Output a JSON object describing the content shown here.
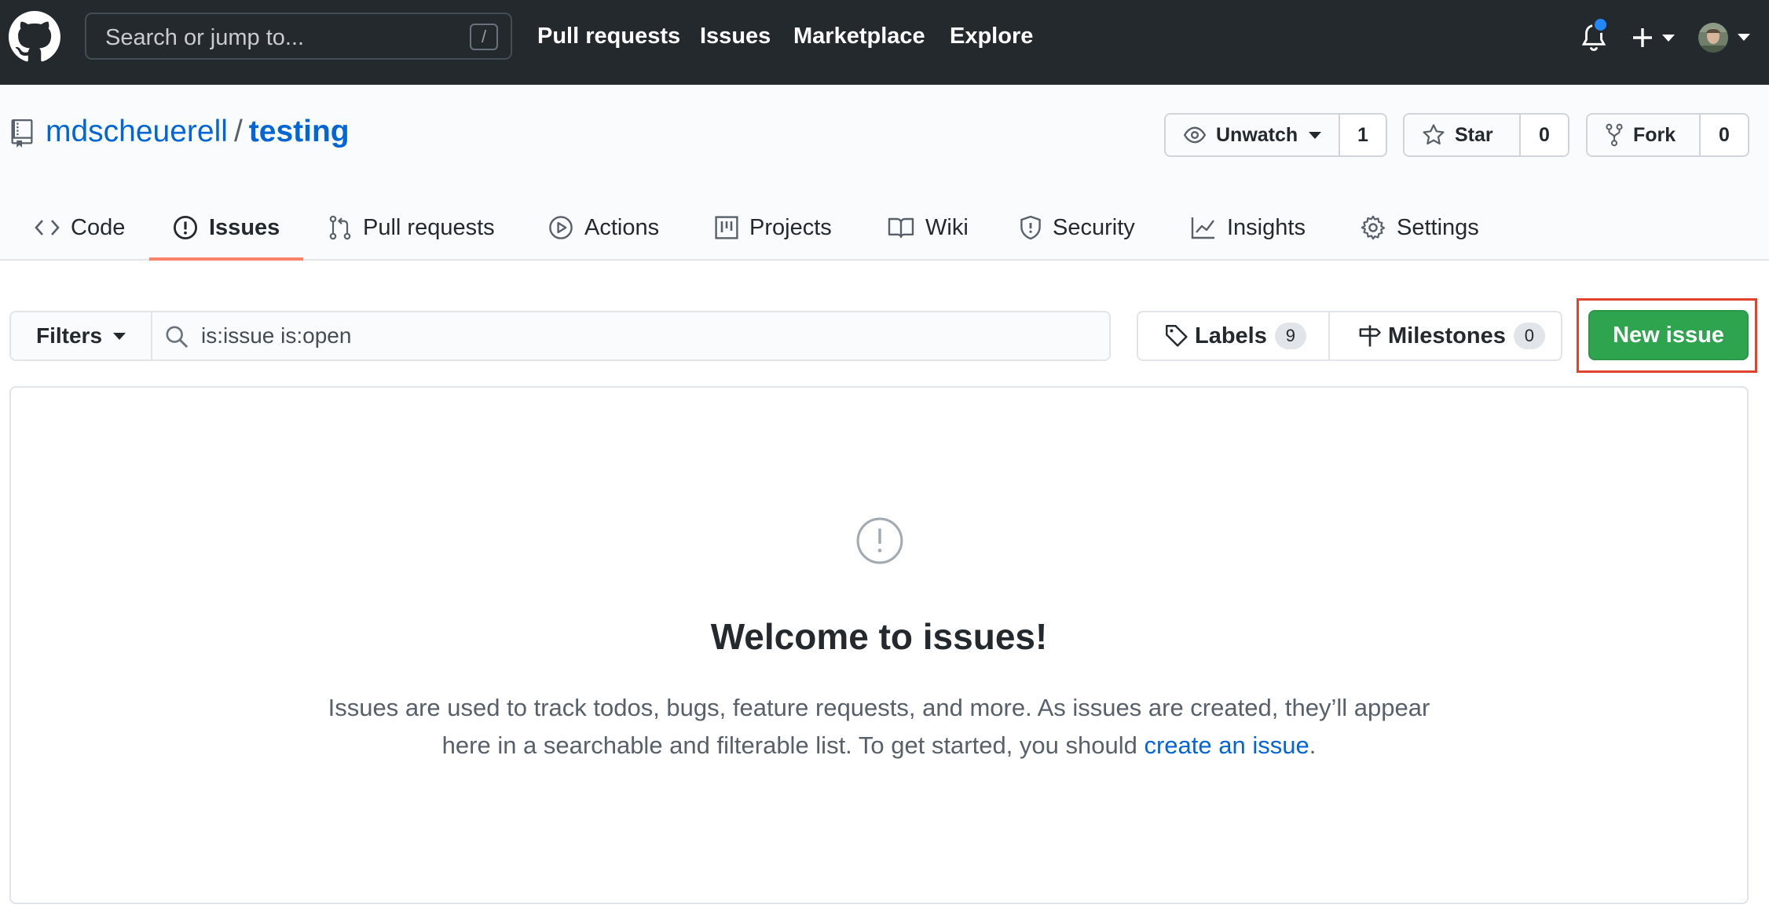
{
  "header": {
    "search_placeholder": "Search or jump to...",
    "search_shortcut": "/",
    "nav": [
      "Pull requests",
      "Issues",
      "Marketplace",
      "Explore"
    ]
  },
  "repo": {
    "owner": "mdscheuerell",
    "separator": "/",
    "name": "testing",
    "watch_label": "Unwatch",
    "watch_count": "1",
    "star_label": "Star",
    "star_count": "0",
    "fork_label": "Fork",
    "fork_count": "0"
  },
  "tabs": [
    {
      "label": "Code",
      "icon": "code-icon"
    },
    {
      "label": "Issues",
      "icon": "issue-opened-icon",
      "selected": true
    },
    {
      "label": "Pull requests",
      "icon": "git-pull-request-icon"
    },
    {
      "label": "Actions",
      "icon": "play-icon"
    },
    {
      "label": "Projects",
      "icon": "project-icon"
    },
    {
      "label": "Wiki",
      "icon": "book-icon"
    },
    {
      "label": "Security",
      "icon": "shield-icon"
    },
    {
      "label": "Insights",
      "icon": "graph-icon"
    },
    {
      "label": "Settings",
      "icon": "gear-icon"
    }
  ],
  "subnav": {
    "filters_label": "Filters",
    "search_value": "is:issue is:open",
    "labels_label": "Labels",
    "labels_count": "9",
    "milestones_label": "Milestones",
    "milestones_count": "0",
    "new_issue_label": "New issue"
  },
  "blankslate": {
    "title": "Welcome to issues!",
    "text_before": "Issues are used to track todos, bugs, feature requests, and more. As issues are created, they’ll appear here in a searchable and filterable list. To get started, you should ",
    "link": "create an issue",
    "text_after": "."
  },
  "colors": {
    "header_bg": "#24292e",
    "link": "#0366d6",
    "primary_button": "#2ea44f",
    "tab_underline": "#f9826c",
    "highlight_box": "#e0442c",
    "notification_dot": "#2188ff"
  }
}
